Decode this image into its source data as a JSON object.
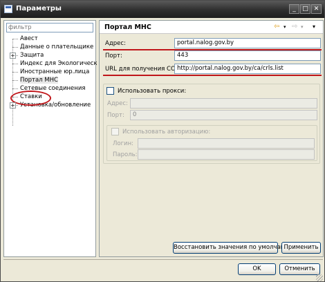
{
  "window": {
    "title": "Параметры"
  },
  "filter": {
    "placeholder": "фильтр"
  },
  "tree": {
    "items": [
      {
        "label": "Авест"
      },
      {
        "label": "Данные о плательщике"
      },
      {
        "label": "Защита",
        "expandable": true
      },
      {
        "label": "Индекс для Экологического"
      },
      {
        "label": "Иностранные юр.лица"
      },
      {
        "label": "Портал МНС",
        "selected": true
      },
      {
        "label": "Сетевые соединения"
      },
      {
        "label": "Ставки"
      },
      {
        "label": "Установка/обновление",
        "expandable": true
      }
    ],
    "expander_symbol": "+"
  },
  "page": {
    "title": "Портал МНС",
    "nav": {
      "back": "⇦",
      "forward": "⇨",
      "dropdown": "▾",
      "menu": "▾"
    },
    "address": {
      "label": "Адрес:",
      "value": "portal.nalog.gov.by"
    },
    "port": {
      "label": "Порт:",
      "value": "443"
    },
    "crl": {
      "label": "URL для получения СОС:",
      "value": "http://portal.nalog.gov.by/ca/crls.list"
    },
    "proxy": {
      "checkbox_label": "Использовать прокси:",
      "checked": false,
      "address_label": "Адрес:",
      "address_value": "",
      "port_label": "Порт:",
      "port_value": "0",
      "auth_checkbox_label": "Использовать авторизацию:",
      "login_label": "Логин:",
      "login_value": "",
      "password_label": "Пароль:",
      "password_value": ""
    },
    "restore_defaults_label": "Восстановить значения по умолчанию",
    "apply_label": "Применить"
  },
  "footer": {
    "ok_label": "OK",
    "cancel_label": "Отменить"
  },
  "colors": {
    "annotation_red": "#c0161a",
    "titlebar": "#2e2e2e",
    "dialog_bg": "#ece9d8"
  }
}
